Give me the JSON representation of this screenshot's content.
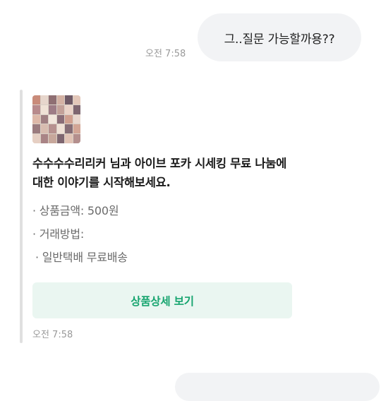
{
  "chat": {
    "outgoing_message": "그..질문 가능할까용??",
    "outgoing_time": "오전 7:58"
  },
  "card": {
    "thumbnail_icon": "product-photo",
    "title": "수수수수리리커 님과 아이브 포카 시세킹 무료 나눔에 대한 이야기를 시작해보세요.",
    "price_line": "· 상품금액: 500원",
    "method_label": "· 거래방법:",
    "method_value": "· 일반택배 무료배송",
    "detail_button": "상품상세 보기",
    "time": "오전 7:58"
  },
  "colors": {
    "accent": "#18a570",
    "button_bg": "#eaf6f1",
    "bubble_bg": "#f2f3f5",
    "muted_text": "#9a9a9a"
  }
}
